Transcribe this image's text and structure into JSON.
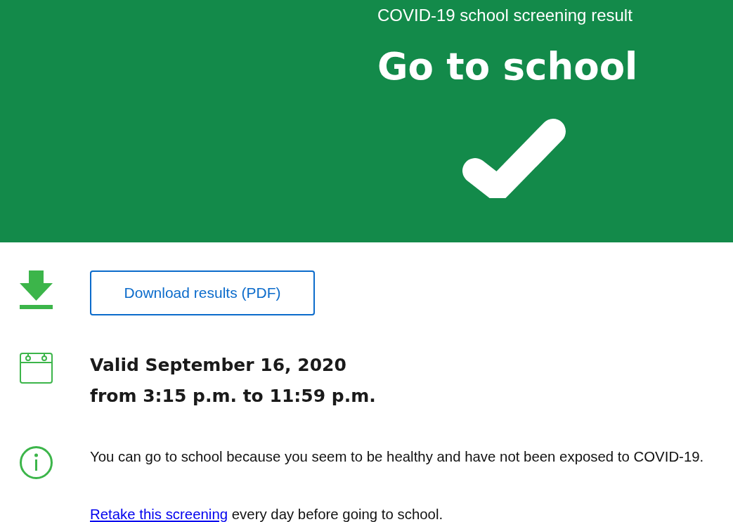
{
  "banner": {
    "subtitle": "COVID-19 school screening result",
    "result": "Go to school"
  },
  "download": {
    "label": "Download results (PDF)"
  },
  "validity": {
    "date_line": "Valid September 16, 2020",
    "time_line": "from 3:15 p.m. to 11:59 p.m."
  },
  "info": {
    "message": "You can go to school because you seem to be healthy and have not been exposed to COVID-19."
  },
  "retake": {
    "link": "Retake this screening",
    "rest": " every day before going to school."
  }
}
